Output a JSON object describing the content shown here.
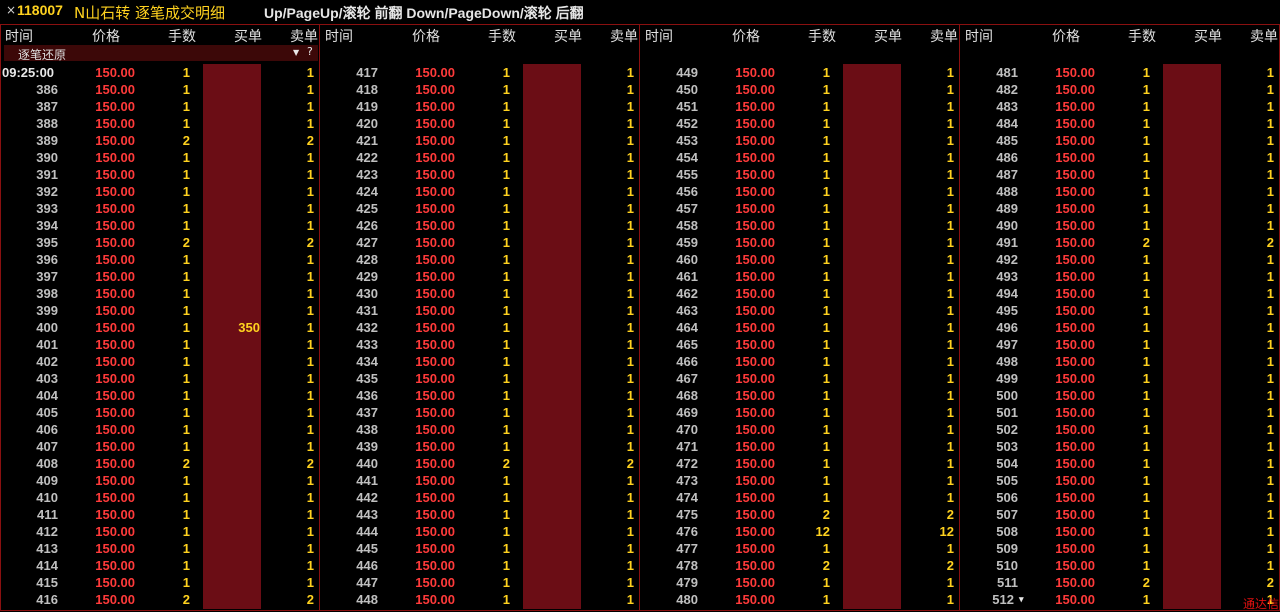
{
  "title": {
    "close": "×",
    "code": "118007",
    "name": "N山石转 逐笔成交明细",
    "hint": "Up/PageUp/滚轮 前翻 Down/PageDown/滚轮 后翻"
  },
  "columns": [
    "时间",
    "价格",
    "手数",
    "买单",
    "卖单"
  ],
  "restore": {
    "label": "逐笔还原",
    "filter_icon": "filter-icon",
    "help_icon": "?"
  },
  "colors": {
    "price": "#ff3a3a",
    "volume": "#ffd21f",
    "bar": "#6b0d15",
    "border": "#8a1010"
  },
  "panels": [
    {
      "rows": [
        {
          "t": "09:25:00",
          "p": "150.00",
          "v": "1",
          "b": "",
          "s": "1"
        },
        {
          "t": "386",
          "p": "150.00",
          "v": "1",
          "b": "",
          "s": "1"
        },
        {
          "t": "387",
          "p": "150.00",
          "v": "1",
          "b": "",
          "s": "1"
        },
        {
          "t": "388",
          "p": "150.00",
          "v": "1",
          "b": "",
          "s": "1"
        },
        {
          "t": "389",
          "p": "150.00",
          "v": "2",
          "b": "",
          "s": "2"
        },
        {
          "t": "390",
          "p": "150.00",
          "v": "1",
          "b": "",
          "s": "1"
        },
        {
          "t": "391",
          "p": "150.00",
          "v": "1",
          "b": "",
          "s": "1"
        },
        {
          "t": "392",
          "p": "150.00",
          "v": "1",
          "b": "",
          "s": "1"
        },
        {
          "t": "393",
          "p": "150.00",
          "v": "1",
          "b": "",
          "s": "1"
        },
        {
          "t": "394",
          "p": "150.00",
          "v": "1",
          "b": "",
          "s": "1"
        },
        {
          "t": "395",
          "p": "150.00",
          "v": "2",
          "b": "",
          "s": "2"
        },
        {
          "t": "396",
          "p": "150.00",
          "v": "1",
          "b": "",
          "s": "1"
        },
        {
          "t": "397",
          "p": "150.00",
          "v": "1",
          "b": "",
          "s": "1"
        },
        {
          "t": "398",
          "p": "150.00",
          "v": "1",
          "b": "",
          "s": "1"
        },
        {
          "t": "399",
          "p": "150.00",
          "v": "1",
          "b": "",
          "s": "1"
        },
        {
          "t": "400",
          "p": "150.00",
          "v": "1",
          "b": "350",
          "s": "1"
        },
        {
          "t": "401",
          "p": "150.00",
          "v": "1",
          "b": "",
          "s": "1"
        },
        {
          "t": "402",
          "p": "150.00",
          "v": "1",
          "b": "",
          "s": "1"
        },
        {
          "t": "403",
          "p": "150.00",
          "v": "1",
          "b": "",
          "s": "1"
        },
        {
          "t": "404",
          "p": "150.00",
          "v": "1",
          "b": "",
          "s": "1"
        },
        {
          "t": "405",
          "p": "150.00",
          "v": "1",
          "b": "",
          "s": "1"
        },
        {
          "t": "406",
          "p": "150.00",
          "v": "1",
          "b": "",
          "s": "1"
        },
        {
          "t": "407",
          "p": "150.00",
          "v": "1",
          "b": "",
          "s": "1"
        },
        {
          "t": "408",
          "p": "150.00",
          "v": "2",
          "b": "",
          "s": "2"
        },
        {
          "t": "409",
          "p": "150.00",
          "v": "1",
          "b": "",
          "s": "1"
        },
        {
          "t": "410",
          "p": "150.00",
          "v": "1",
          "b": "",
          "s": "1"
        },
        {
          "t": "411",
          "p": "150.00",
          "v": "1",
          "b": "",
          "s": "1"
        },
        {
          "t": "412",
          "p": "150.00",
          "v": "1",
          "b": "",
          "s": "1"
        },
        {
          "t": "413",
          "p": "150.00",
          "v": "1",
          "b": "",
          "s": "1"
        },
        {
          "t": "414",
          "p": "150.00",
          "v": "1",
          "b": "",
          "s": "1"
        },
        {
          "t": "415",
          "p": "150.00",
          "v": "1",
          "b": "",
          "s": "1"
        },
        {
          "t": "416",
          "p": "150.00",
          "v": "2",
          "b": "",
          "s": "2"
        }
      ]
    },
    {
      "rows": [
        {
          "t": "417",
          "p": "150.00",
          "v": "1",
          "b": "",
          "s": "1"
        },
        {
          "t": "418",
          "p": "150.00",
          "v": "1",
          "b": "",
          "s": "1"
        },
        {
          "t": "419",
          "p": "150.00",
          "v": "1",
          "b": "",
          "s": "1"
        },
        {
          "t": "420",
          "p": "150.00",
          "v": "1",
          "b": "",
          "s": "1"
        },
        {
          "t": "421",
          "p": "150.00",
          "v": "1",
          "b": "",
          "s": "1"
        },
        {
          "t": "422",
          "p": "150.00",
          "v": "1",
          "b": "",
          "s": "1"
        },
        {
          "t": "423",
          "p": "150.00",
          "v": "1",
          "b": "",
          "s": "1"
        },
        {
          "t": "424",
          "p": "150.00",
          "v": "1",
          "b": "",
          "s": "1"
        },
        {
          "t": "425",
          "p": "150.00",
          "v": "1",
          "b": "",
          "s": "1"
        },
        {
          "t": "426",
          "p": "150.00",
          "v": "1",
          "b": "",
          "s": "1"
        },
        {
          "t": "427",
          "p": "150.00",
          "v": "1",
          "b": "",
          "s": "1"
        },
        {
          "t": "428",
          "p": "150.00",
          "v": "1",
          "b": "",
          "s": "1"
        },
        {
          "t": "429",
          "p": "150.00",
          "v": "1",
          "b": "",
          "s": "1"
        },
        {
          "t": "430",
          "p": "150.00",
          "v": "1",
          "b": "",
          "s": "1"
        },
        {
          "t": "431",
          "p": "150.00",
          "v": "1",
          "b": "",
          "s": "1"
        },
        {
          "t": "432",
          "p": "150.00",
          "v": "1",
          "b": "",
          "s": "1"
        },
        {
          "t": "433",
          "p": "150.00",
          "v": "1",
          "b": "",
          "s": "1"
        },
        {
          "t": "434",
          "p": "150.00",
          "v": "1",
          "b": "",
          "s": "1"
        },
        {
          "t": "435",
          "p": "150.00",
          "v": "1",
          "b": "",
          "s": "1"
        },
        {
          "t": "436",
          "p": "150.00",
          "v": "1",
          "b": "",
          "s": "1"
        },
        {
          "t": "437",
          "p": "150.00",
          "v": "1",
          "b": "",
          "s": "1"
        },
        {
          "t": "438",
          "p": "150.00",
          "v": "1",
          "b": "",
          "s": "1"
        },
        {
          "t": "439",
          "p": "150.00",
          "v": "1",
          "b": "",
          "s": "1"
        },
        {
          "t": "440",
          "p": "150.00",
          "v": "2",
          "b": "",
          "s": "2"
        },
        {
          "t": "441",
          "p": "150.00",
          "v": "1",
          "b": "",
          "s": "1"
        },
        {
          "t": "442",
          "p": "150.00",
          "v": "1",
          "b": "",
          "s": "1"
        },
        {
          "t": "443",
          "p": "150.00",
          "v": "1",
          "b": "",
          "s": "1"
        },
        {
          "t": "444",
          "p": "150.00",
          "v": "1",
          "b": "",
          "s": "1"
        },
        {
          "t": "445",
          "p": "150.00",
          "v": "1",
          "b": "",
          "s": "1"
        },
        {
          "t": "446",
          "p": "150.00",
          "v": "1",
          "b": "",
          "s": "1"
        },
        {
          "t": "447",
          "p": "150.00",
          "v": "1",
          "b": "",
          "s": "1"
        },
        {
          "t": "448",
          "p": "150.00",
          "v": "1",
          "b": "",
          "s": "1"
        }
      ]
    },
    {
      "rows": [
        {
          "t": "449",
          "p": "150.00",
          "v": "1",
          "b": "",
          "s": "1"
        },
        {
          "t": "450",
          "p": "150.00",
          "v": "1",
          "b": "",
          "s": "1"
        },
        {
          "t": "451",
          "p": "150.00",
          "v": "1",
          "b": "",
          "s": "1"
        },
        {
          "t": "452",
          "p": "150.00",
          "v": "1",
          "b": "",
          "s": "1"
        },
        {
          "t": "453",
          "p": "150.00",
          "v": "1",
          "b": "",
          "s": "1"
        },
        {
          "t": "454",
          "p": "150.00",
          "v": "1",
          "b": "",
          "s": "1"
        },
        {
          "t": "455",
          "p": "150.00",
          "v": "1",
          "b": "",
          "s": "1"
        },
        {
          "t": "456",
          "p": "150.00",
          "v": "1",
          "b": "",
          "s": "1"
        },
        {
          "t": "457",
          "p": "150.00",
          "v": "1",
          "b": "",
          "s": "1"
        },
        {
          "t": "458",
          "p": "150.00",
          "v": "1",
          "b": "",
          "s": "1"
        },
        {
          "t": "459",
          "p": "150.00",
          "v": "1",
          "b": "",
          "s": "1"
        },
        {
          "t": "460",
          "p": "150.00",
          "v": "1",
          "b": "",
          "s": "1"
        },
        {
          "t": "461",
          "p": "150.00",
          "v": "1",
          "b": "",
          "s": "1"
        },
        {
          "t": "462",
          "p": "150.00",
          "v": "1",
          "b": "",
          "s": "1"
        },
        {
          "t": "463",
          "p": "150.00",
          "v": "1",
          "b": "",
          "s": "1"
        },
        {
          "t": "464",
          "p": "150.00",
          "v": "1",
          "b": "",
          "s": "1"
        },
        {
          "t": "465",
          "p": "150.00",
          "v": "1",
          "b": "",
          "s": "1"
        },
        {
          "t": "466",
          "p": "150.00",
          "v": "1",
          "b": "",
          "s": "1"
        },
        {
          "t": "467",
          "p": "150.00",
          "v": "1",
          "b": "",
          "s": "1"
        },
        {
          "t": "468",
          "p": "150.00",
          "v": "1",
          "b": "",
          "s": "1"
        },
        {
          "t": "469",
          "p": "150.00",
          "v": "1",
          "b": "",
          "s": "1"
        },
        {
          "t": "470",
          "p": "150.00",
          "v": "1",
          "b": "",
          "s": "1"
        },
        {
          "t": "471",
          "p": "150.00",
          "v": "1",
          "b": "",
          "s": "1"
        },
        {
          "t": "472",
          "p": "150.00",
          "v": "1",
          "b": "",
          "s": "1"
        },
        {
          "t": "473",
          "p": "150.00",
          "v": "1",
          "b": "",
          "s": "1"
        },
        {
          "t": "474",
          "p": "150.00",
          "v": "1",
          "b": "",
          "s": "1"
        },
        {
          "t": "475",
          "p": "150.00",
          "v": "2",
          "b": "",
          "s": "2"
        },
        {
          "t": "476",
          "p": "150.00",
          "v": "12",
          "b": "",
          "s": "12"
        },
        {
          "t": "477",
          "p": "150.00",
          "v": "1",
          "b": "",
          "s": "1"
        },
        {
          "t": "478",
          "p": "150.00",
          "v": "2",
          "b": "",
          "s": "2"
        },
        {
          "t": "479",
          "p": "150.00",
          "v": "1",
          "b": "",
          "s": "1"
        },
        {
          "t": "480",
          "p": "150.00",
          "v": "1",
          "b": "",
          "s": "1"
        }
      ]
    },
    {
      "rows": [
        {
          "t": "481",
          "p": "150.00",
          "v": "1",
          "b": "",
          "s": "1"
        },
        {
          "t": "482",
          "p": "150.00",
          "v": "1",
          "b": "",
          "s": "1"
        },
        {
          "t": "483",
          "p": "150.00",
          "v": "1",
          "b": "",
          "s": "1"
        },
        {
          "t": "484",
          "p": "150.00",
          "v": "1",
          "b": "",
          "s": "1"
        },
        {
          "t": "485",
          "p": "150.00",
          "v": "1",
          "b": "",
          "s": "1"
        },
        {
          "t": "486",
          "p": "150.00",
          "v": "1",
          "b": "",
          "s": "1"
        },
        {
          "t": "487",
          "p": "150.00",
          "v": "1",
          "b": "",
          "s": "1"
        },
        {
          "t": "488",
          "p": "150.00",
          "v": "1",
          "b": "",
          "s": "1"
        },
        {
          "t": "489",
          "p": "150.00",
          "v": "1",
          "b": "",
          "s": "1"
        },
        {
          "t": "490",
          "p": "150.00",
          "v": "1",
          "b": "",
          "s": "1"
        },
        {
          "t": "491",
          "p": "150.00",
          "v": "2",
          "b": "",
          "s": "2"
        },
        {
          "t": "492",
          "p": "150.00",
          "v": "1",
          "b": "",
          "s": "1"
        },
        {
          "t": "493",
          "p": "150.00",
          "v": "1",
          "b": "",
          "s": "1"
        },
        {
          "t": "494",
          "p": "150.00",
          "v": "1",
          "b": "",
          "s": "1"
        },
        {
          "t": "495",
          "p": "150.00",
          "v": "1",
          "b": "",
          "s": "1"
        },
        {
          "t": "496",
          "p": "150.00",
          "v": "1",
          "b": "",
          "s": "1"
        },
        {
          "t": "497",
          "p": "150.00",
          "v": "1",
          "b": "",
          "s": "1"
        },
        {
          "t": "498",
          "p": "150.00",
          "v": "1",
          "b": "",
          "s": "1"
        },
        {
          "t": "499",
          "p": "150.00",
          "v": "1",
          "b": "",
          "s": "1"
        },
        {
          "t": "500",
          "p": "150.00",
          "v": "1",
          "b": "",
          "s": "1"
        },
        {
          "t": "501",
          "p": "150.00",
          "v": "1",
          "b": "",
          "s": "1"
        },
        {
          "t": "502",
          "p": "150.00",
          "v": "1",
          "b": "",
          "s": "1"
        },
        {
          "t": "503",
          "p": "150.00",
          "v": "1",
          "b": "",
          "s": "1"
        },
        {
          "t": "504",
          "p": "150.00",
          "v": "1",
          "b": "",
          "s": "1"
        },
        {
          "t": "505",
          "p": "150.00",
          "v": "1",
          "b": "",
          "s": "1"
        },
        {
          "t": "506",
          "p": "150.00",
          "v": "1",
          "b": "",
          "s": "1"
        },
        {
          "t": "507",
          "p": "150.00",
          "v": "1",
          "b": "",
          "s": "1"
        },
        {
          "t": "508",
          "p": "150.00",
          "v": "1",
          "b": "",
          "s": "1"
        },
        {
          "t": "509",
          "p": "150.00",
          "v": "1",
          "b": "",
          "s": "1"
        },
        {
          "t": "510",
          "p": "150.00",
          "v": "1",
          "b": "",
          "s": "1"
        },
        {
          "t": "511",
          "p": "150.00",
          "v": "2",
          "b": "",
          "s": "2"
        },
        {
          "t": "512",
          "p": "150.00",
          "v": "1",
          "b": "",
          "s": "1"
        }
      ]
    }
  ],
  "caret": "▾",
  "footer": {
    "more": "通达信"
  }
}
